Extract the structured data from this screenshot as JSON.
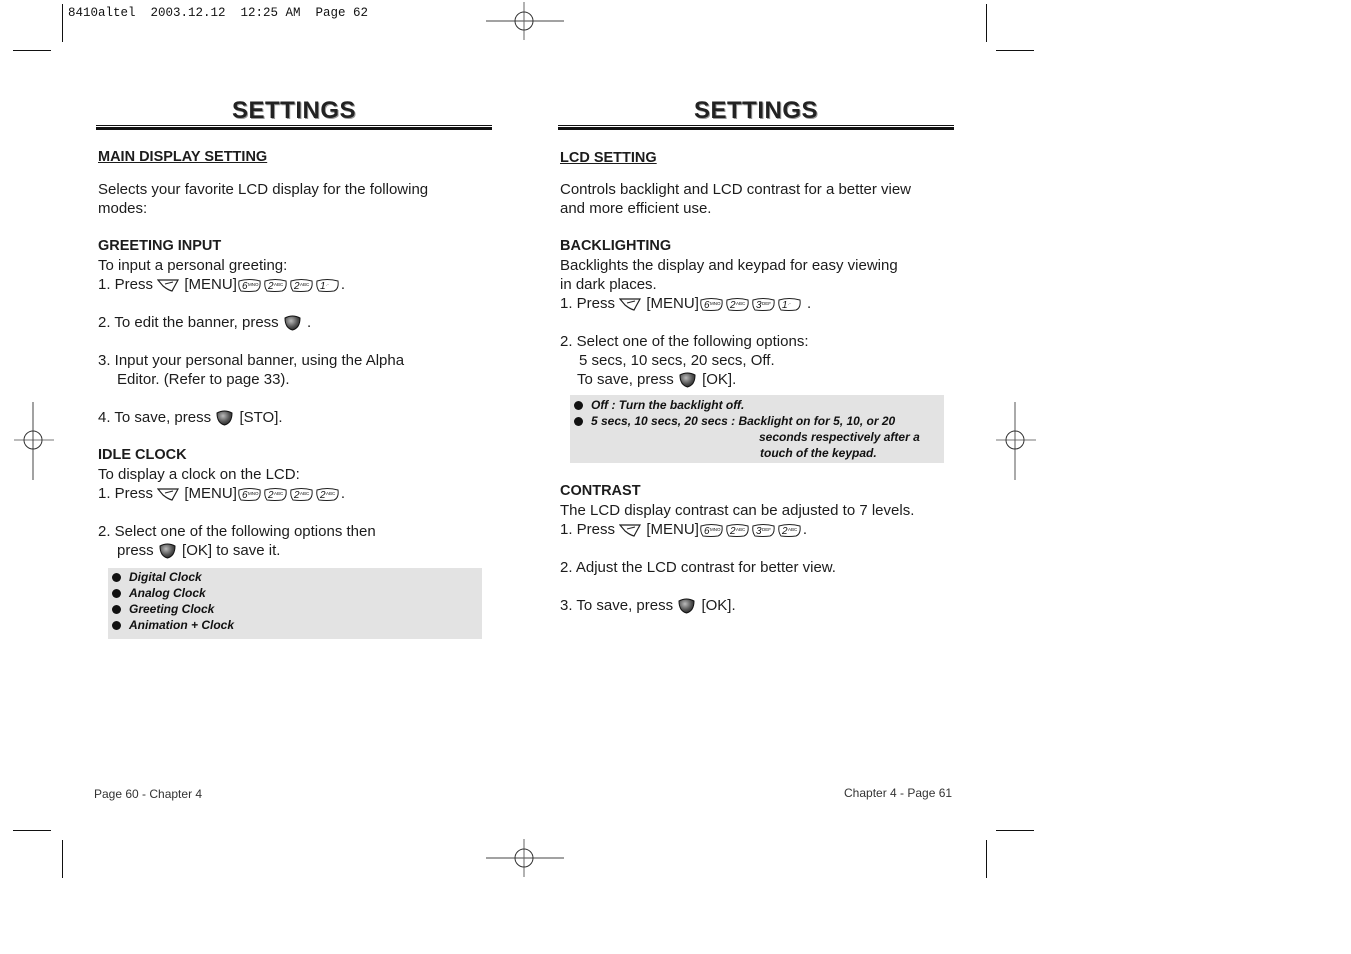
{
  "print_header": "8410altel  2003.12.12  12:25 AM  Page 62",
  "left_page": {
    "title": "SETTINGS",
    "section_title": "MAIN DISPLAY SETTING",
    "intro": [
      "Selects your favorite LCD display for the following",
      "modes:"
    ],
    "greeting": {
      "heading": "GREETING INPUT",
      "line1": "To input a personal greeting:",
      "step1_prefix": "1. Press",
      "menu": "[MENU]",
      "step1_keys": [
        "6",
        "2",
        "2",
        "1"
      ],
      "step2": "2. To edit the banner, press",
      "step2_suffix": ".",
      "step3a": "3. Input your personal banner, using the Alpha",
      "step3b": "Editor. (Refer to page 33).",
      "step4": "4. To save, press",
      "step4_suffix": "[STO]."
    },
    "idle_clock": {
      "heading": "IDLE CLOCK",
      "line1": "To display a clock on the LCD:",
      "step1_prefix": "1. Press",
      "menu": "[MENU]",
      "step1_keys": [
        "6",
        "2",
        "2",
        "2"
      ],
      "step2a": "2. Select one of the following options then",
      "step2b_prefix": "press",
      "step2b_suffix": "[OK] to save it.",
      "options": [
        "Digital Clock",
        "Analog Clock",
        "Greeting Clock",
        "Animation + Clock"
      ]
    },
    "footer": "Page 60 - Chapter 4"
  },
  "right_page": {
    "title": "SETTINGS",
    "section_title": "LCD SETTING",
    "intro": [
      "Controls backlight and LCD contrast for a better view",
      "and more efficient use."
    ],
    "backlighting": {
      "heading": "BACKLIGHTING",
      "line1": "Backlights the display and keypad for easy viewing",
      "line2": "in dark places.",
      "step1_prefix": "1. Press",
      "menu": "[MENU]",
      "step1_keys": [
        "6",
        "2",
        "3",
        "1"
      ],
      "step2a": "2. Select one of the following options:",
      "step2b": "5 secs, 10 secs, 20 secs, Off.",
      "step2c_prefix": "To save, press",
      "step2c_suffix": "[OK].",
      "notes": [
        {
          "term": "Off",
          "desc": "Turn the backlight off."
        },
        {
          "term": "5 secs, 10 secs, 20 secs",
          "desc": [
            "Backlight on for 5, 10, or 20",
            "seconds respectively after a",
            "touch of the keypad."
          ]
        }
      ]
    },
    "contrast": {
      "heading": "CONTRAST",
      "line1": "The LCD display contrast can be adjusted to 7 levels.",
      "step1_prefix": "1. Press",
      "menu": "[MENU]",
      "step1_keys": [
        "6",
        "2",
        "3",
        "2"
      ],
      "step2": "2. Adjust the LCD contrast for better view.",
      "step3_prefix": "3. To save, press",
      "step3_suffix": "[OK]."
    },
    "footer": "Chapter 4 - Page 61"
  },
  "key_subscripts": {
    "1": ".-",
    "2": "ABC",
    "3": "DEF",
    "6": "MNO"
  }
}
